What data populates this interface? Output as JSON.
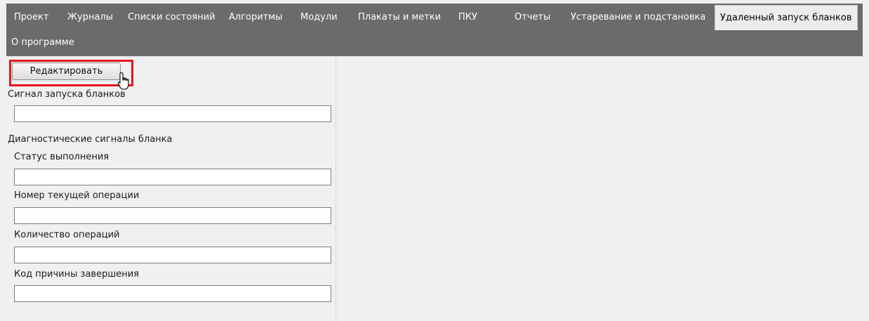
{
  "menu": {
    "items": [
      "Проект",
      "Журналы",
      "Списки состояний",
      "Алгоритмы",
      "Модули",
      "Плакаты и метки",
      "ПКУ",
      "Отчеты",
      "Устаревание и подстановка",
      "Удаленный запуск бланков",
      "О программе"
    ],
    "active": "Удаленный запуск бланков"
  },
  "toolbar": {
    "edit_label": "Редактировать"
  },
  "form": {
    "launch_signal_label": "Сигнал запуска бланков",
    "launch_signal_value": "",
    "diagnostics_heading": "Диагностические сигналы бланка",
    "status_label": "Статус выполнения",
    "status_value": "",
    "current_op_label": "Номер текущей операции",
    "current_op_value": "",
    "op_count_label": "Количество операций",
    "op_count_value": "",
    "finish_code_label": "Код причины завершения",
    "finish_code_value": ""
  },
  "colors": {
    "menubar": "#6b6b6b",
    "highlight": "#e8141c",
    "background": "#f0f0f0"
  },
  "icons": {
    "cursor": "hand-pointer-icon"
  }
}
